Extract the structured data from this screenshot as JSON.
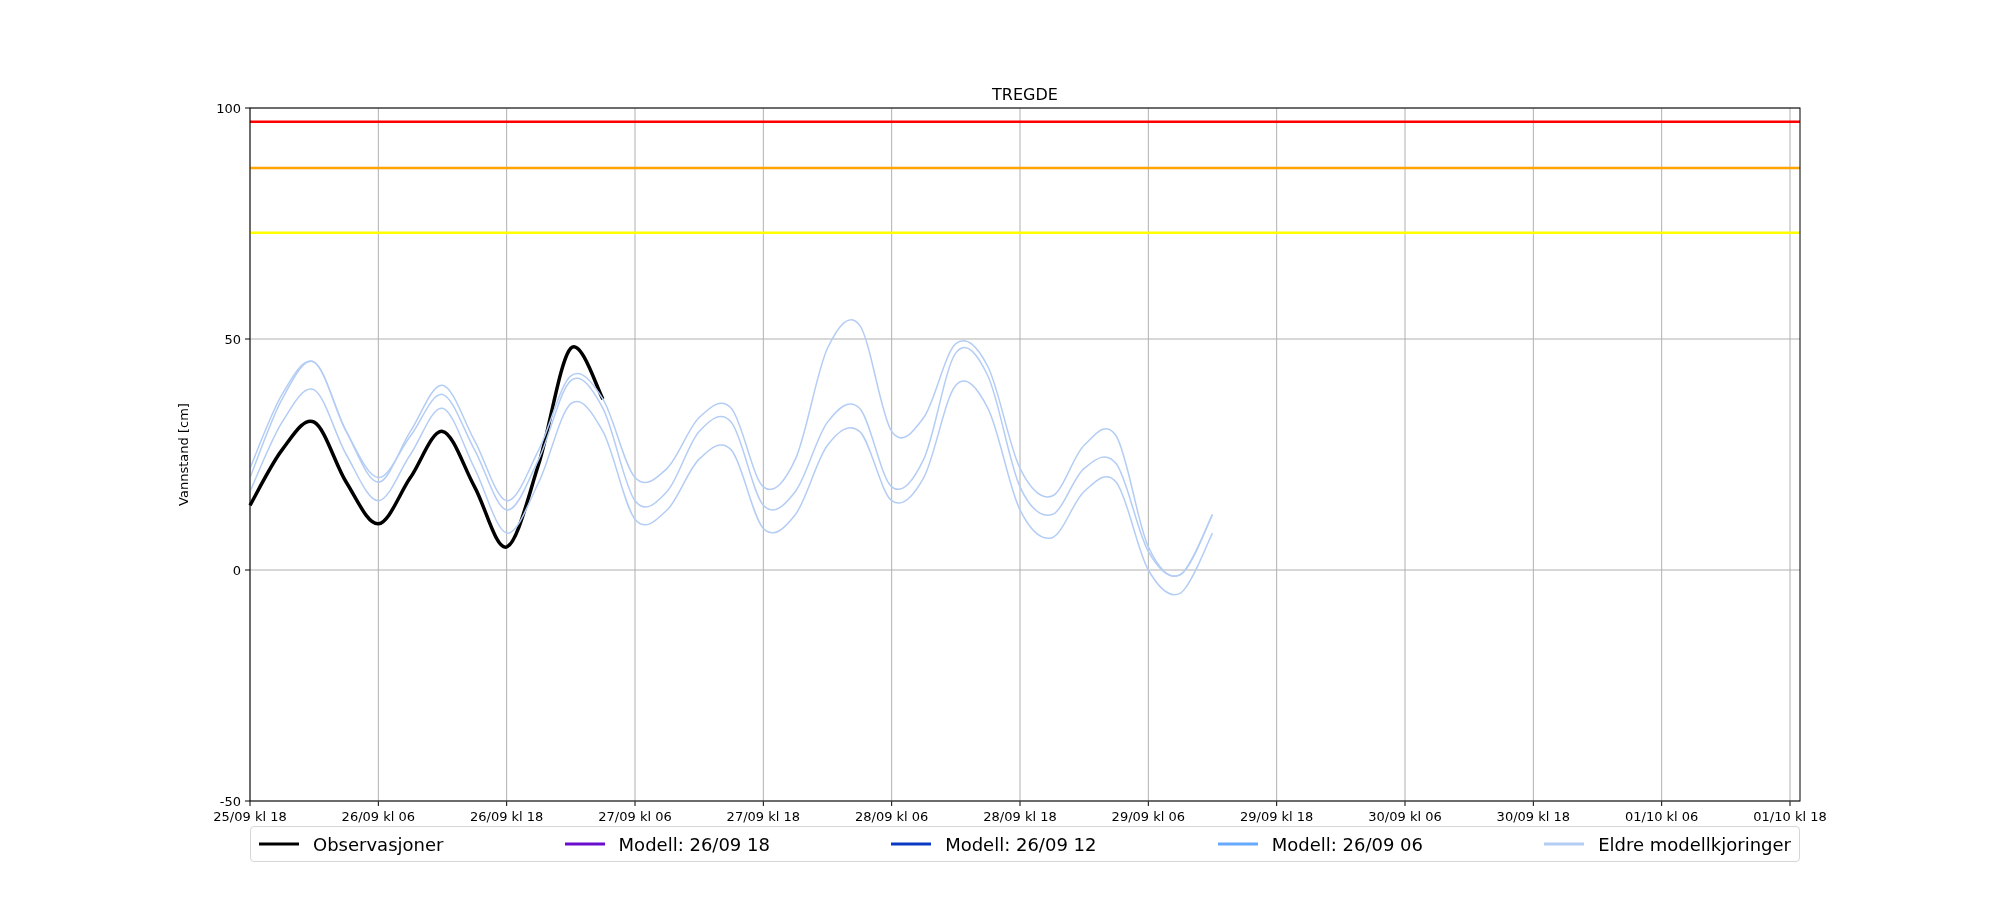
{
  "chart_data": {
    "type": "line",
    "title": "TREGDE",
    "ylabel": "Vannstand [cm]",
    "categories": [
      "25/09 kl 18",
      null,
      null,
      null,
      "26/09 kl 06",
      null,
      null,
      null,
      "26/09 kl 18",
      null,
      null,
      null,
      "27/09 kl 06",
      null,
      null,
      null,
      "27/09 kl 18",
      null,
      null,
      null,
      "28/09 kl 06",
      null,
      null,
      null,
      "28/09 kl 18",
      null,
      null,
      null,
      "29/09 kl 06",
      null,
      null,
      null,
      "29/09 kl 18",
      null,
      null,
      null,
      "30/09 kl 06",
      null,
      null,
      null,
      "30/09 kl 18",
      null,
      null,
      null,
      "01/10 kl 06",
      null,
      null,
      null,
      "01/10 kl 18"
    ],
    "ylim": [
      -50,
      100
    ],
    "yticks": [
      -50,
      0,
      50,
      100
    ],
    "grid": true,
    "ref_lines": [
      {
        "axis": "y",
        "value": 97,
        "color": "#ff0000"
      },
      {
        "axis": "y",
        "value": 87,
        "color": "#ffa500"
      },
      {
        "axis": "y",
        "value": 73,
        "color": "#ffff00"
      }
    ],
    "series": [
      {
        "name": "Observasjoner",
        "color": "#000000",
        "values": [
          14,
          26,
          32,
          19,
          10,
          20,
          30,
          18,
          5,
          23,
          48,
          37,
          null,
          null,
          null,
          null,
          null,
          null,
          null,
          null,
          null,
          null,
          null,
          null,
          null,
          null,
          null,
          null,
          null,
          null,
          null,
          null,
          null,
          null,
          null,
          null,
          null,
          null,
          null,
          null,
          null,
          null,
          null,
          null,
          null,
          null,
          null,
          null,
          null
        ]
      },
      {
        "name": "Modell: 26/09 18",
        "color": "#6a0dcc",
        "values": [
          null,
          null,
          null,
          null,
          null,
          null,
          null,
          null,
          null,
          null,
          null,
          null,
          null,
          null,
          null,
          null,
          null,
          null,
          null,
          null,
          null,
          null,
          null,
          null,
          null,
          null,
          null,
          null,
          null,
          null,
          null,
          null,
          null,
          null,
          null,
          null,
          null,
          null,
          null,
          null,
          null,
          null,
          null,
          null,
          null,
          null,
          null,
          null,
          null
        ]
      },
      {
        "name": "Modell: 26/09 12",
        "color": "#0a3ac4",
        "values": [
          null,
          null,
          null,
          null,
          null,
          null,
          null,
          null,
          null,
          null,
          null,
          null,
          null,
          null,
          null,
          null,
          null,
          null,
          null,
          null,
          null,
          null,
          null,
          null,
          null,
          null,
          null,
          null,
          null,
          null,
          null,
          null,
          null,
          null,
          null,
          null,
          null,
          null,
          null,
          null,
          null,
          null,
          null,
          null,
          null,
          null,
          null,
          null,
          null
        ]
      },
      {
        "name": "Modell: 26/09 06",
        "color": "#66aaff",
        "values": [
          null,
          null,
          null,
          null,
          null,
          null,
          null,
          null,
          null,
          null,
          null,
          null,
          null,
          null,
          null,
          null,
          null,
          null,
          null,
          null,
          null,
          null,
          null,
          null,
          null,
          null,
          null,
          null,
          null,
          null,
          null,
          null,
          null,
          null,
          null,
          null,
          null,
          null,
          null,
          null,
          null,
          null,
          null,
          null,
          null,
          null,
          null,
          null,
          null
        ]
      },
      {
        "name": "Eldre modellkjoringer",
        "color": "#b4cdf5",
        "values": [
          22,
          38,
          45,
          30,
          19,
          30,
          40,
          28,
          15,
          26,
          42,
          37,
          20,
          22,
          33,
          35,
          18,
          24,
          48,
          53,
          30,
          33,
          49,
          44,
          22,
          16,
          27,
          29,
          5,
          -1,
          12,
          null,
          null,
          null,
          null,
          null,
          null,
          null,
          null,
          null,
          null,
          null,
          null,
          null,
          null,
          null,
          null,
          null,
          null
        ]
      },
      {
        "color": "#b4cdf5",
        "values": [
          20,
          37,
          45,
          30,
          20,
          29,
          38,
          26,
          13,
          24,
          41,
          35,
          15,
          17,
          30,
          32,
          14,
          17,
          32,
          35,
          18,
          24,
          47,
          42,
          18,
          12,
          22,
          23,
          4,
          -1,
          12,
          null,
          null,
          null,
          null,
          null,
          null,
          null,
          null,
          null,
          null,
          null,
          null,
          null,
          null,
          null,
          null,
          null,
          null
        ]
      },
      {
        "color": "#b4cdf5",
        "values": [
          17,
          32,
          39,
          25,
          15,
          25,
          35,
          22,
          8,
          19,
          36,
          30,
          11,
          13,
          24,
          26,
          9,
          12,
          27,
          30,
          15,
          20,
          40,
          35,
          13,
          7,
          17,
          19,
          0,
          -5,
          8,
          null,
          null,
          null,
          null,
          null,
          null,
          null,
          null,
          null,
          null,
          null,
          null,
          null,
          null,
          null,
          null,
          null,
          null
        ]
      }
    ]
  }
}
